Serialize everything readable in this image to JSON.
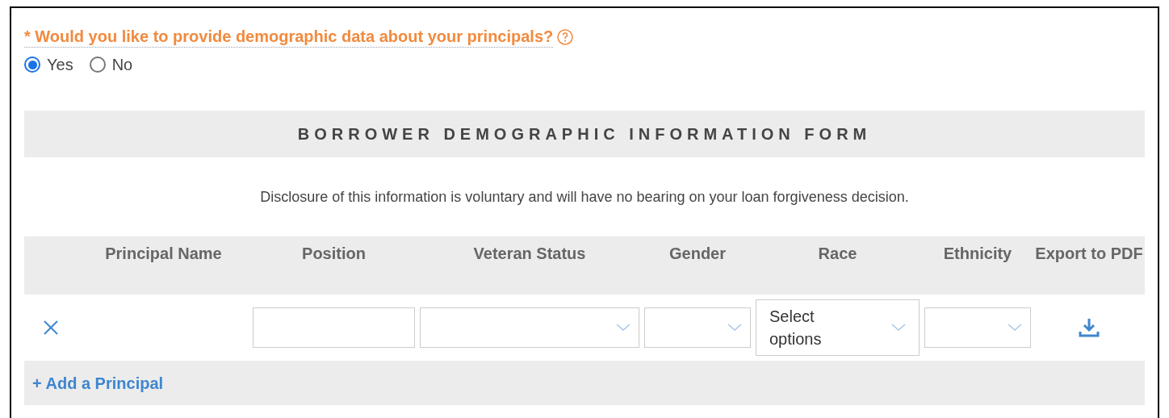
{
  "question": {
    "label": "* Would you like to provide demographic data about your principals?",
    "options": [
      {
        "label": "Yes",
        "selected": true
      },
      {
        "label": "No",
        "selected": false
      }
    ]
  },
  "form": {
    "title": "BORROWER DEMOGRAPHIC INFORMATION FORM",
    "disclosure": "Disclosure of this information is voluntary and will have no bearing on your loan forgiveness decision.",
    "columns": [
      "Principal Name",
      "Position",
      "Veteran Status",
      "Gender",
      "Race",
      "Ethnicity",
      "Export to PDF"
    ],
    "rows": [
      {
        "cells": [
          {
            "kind": "empty"
          },
          {
            "kind": "text"
          },
          {
            "kind": "select"
          },
          {
            "kind": "select"
          },
          {
            "kind": "multiselect",
            "placeholder": "Select options"
          },
          {
            "kind": "select"
          },
          {
            "kind": "export"
          }
        ]
      }
    ],
    "add_button": "+ Add a Principal"
  }
}
